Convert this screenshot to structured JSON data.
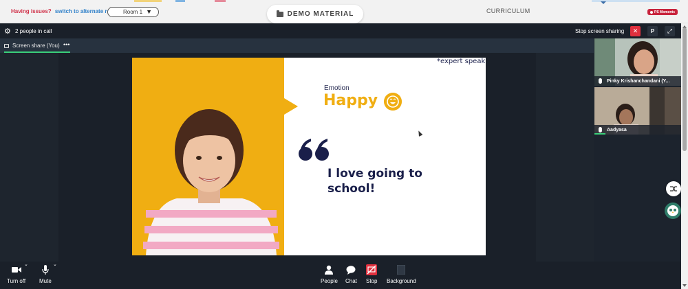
{
  "header": {
    "issues_text": "Having issues?",
    "switch_link": "switch to alternate room",
    "room_select": "Room 1",
    "demo_material": "DEMO MATERIAL",
    "curriculum": "CURRICULUM",
    "badge": "PS Moments"
  },
  "call": {
    "people_in_call": "2 people in call",
    "stop_screen_sharing": "Stop screen sharing",
    "p_button": "P",
    "screen_share_label": "Screen share (You)",
    "more_dots": "•••"
  },
  "slide": {
    "expert_speak": "*expert speak",
    "emotion_label": "Emotion",
    "emotion_value": "Happy",
    "quote": "I love going to school!"
  },
  "participants": [
    {
      "name": "Pinky Krishanchandani (Y..."
    },
    {
      "name": "Aadyasa"
    }
  ],
  "toolbar": {
    "turn_off": "Turn off",
    "mute": "Mute",
    "people": "People",
    "chat": "Chat",
    "stop": "Stop",
    "background": "Background"
  },
  "colors": {
    "slide_yellow": "#f0ae12",
    "slide_navy": "#1a1f4a",
    "stop_red": "#e0303e",
    "active_green": "#3ad07a",
    "call_bg": "#1c232d"
  }
}
